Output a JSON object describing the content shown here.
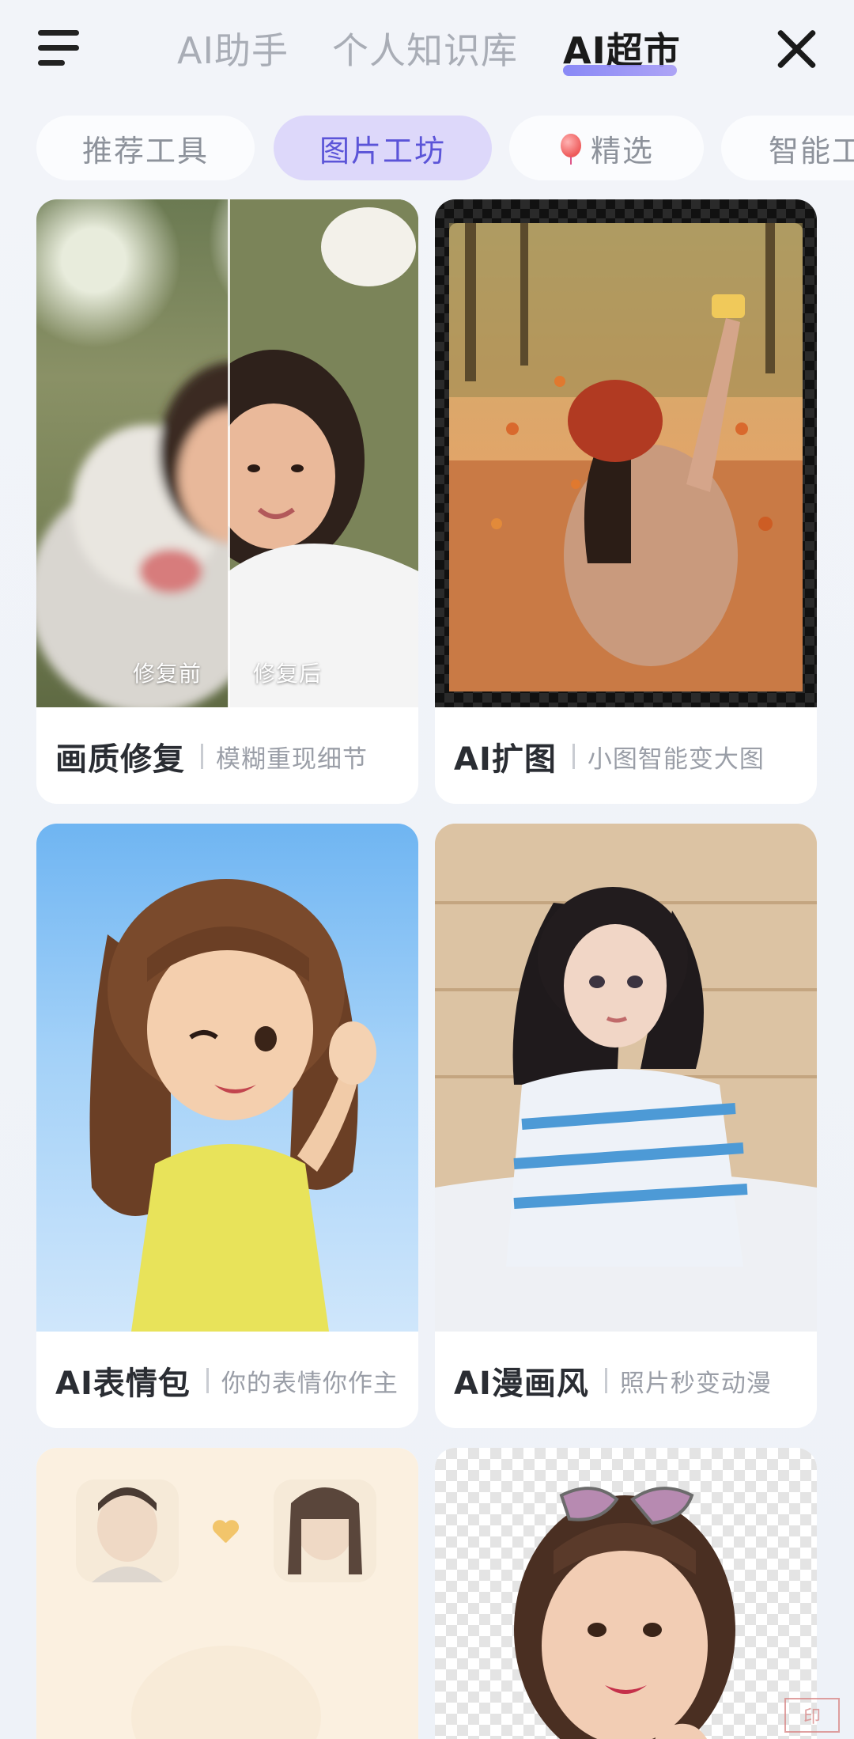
{
  "header": {
    "tabs": [
      {
        "label": "AI助手"
      },
      {
        "label": "个人知识库"
      },
      {
        "label": "AI超市",
        "active": true
      }
    ]
  },
  "chips": [
    {
      "label": "推荐工具"
    },
    {
      "label": "图片工坊",
      "active": true
    },
    {
      "label": "精选",
      "icon": "balloon-icon"
    },
    {
      "label": "智能工"
    }
  ],
  "cards": [
    {
      "title": "画质修复",
      "subtitle": "模糊重现细节",
      "before_label": "修复前",
      "after_label": "修复后"
    },
    {
      "title": "AI扩图",
      "subtitle": "小图智能变大图"
    },
    {
      "title": "AI表情包",
      "subtitle": "你的表情你作主"
    },
    {
      "title": "AI漫画风",
      "subtitle": "照片秒变动漫"
    },
    {
      "title": "",
      "subtitle": ""
    },
    {
      "title": "",
      "subtitle": ""
    }
  ],
  "colors": {
    "accent": "#5b54d8",
    "active_chip_bg": "#ddd8fa",
    "background": "#eef2f8"
  }
}
